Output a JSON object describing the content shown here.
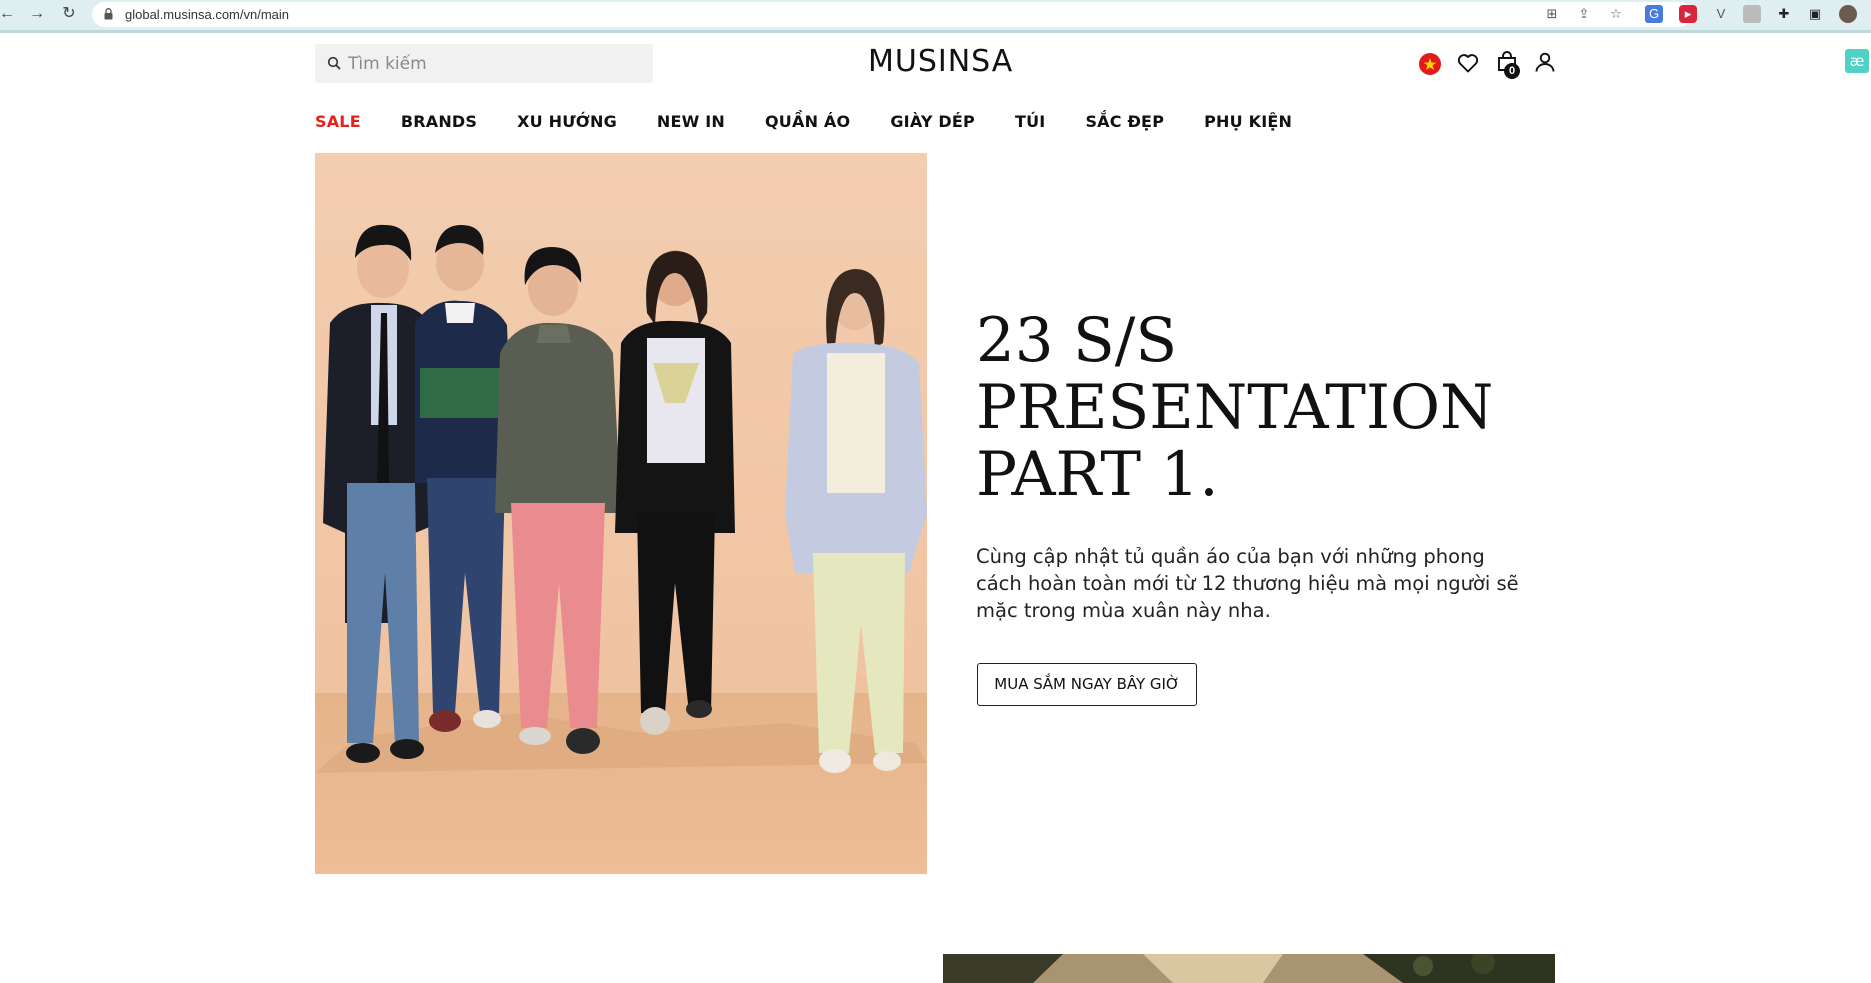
{
  "browser": {
    "url": "global.musinsa.com/vn/main",
    "back_icon": "back-arrow-icon",
    "forward_icon": "forward-arrow-icon",
    "reload_icon": "reload-icon",
    "extensions": [
      "translate-icon",
      "share-icon",
      "star-icon",
      "google-translate-icon",
      "record-icon",
      "v-extension-icon",
      "image-extension-icon",
      "puzzle-icon",
      "sidebar-icon",
      "profile-avatar"
    ]
  },
  "header": {
    "search_placeholder": "Tìm kiếm",
    "logo": "MUSINSA",
    "cart_count": "0",
    "side_badge": "æ"
  },
  "nav": {
    "items": [
      {
        "label": "SALE"
      },
      {
        "label": "BRANDS"
      },
      {
        "label": "XU HƯỚNG"
      },
      {
        "label": "NEW IN"
      },
      {
        "label": "QUẦN ÁO"
      },
      {
        "label": "GIÀY DÉP"
      },
      {
        "label": "TÚI"
      },
      {
        "label": "SẮC ĐẸP"
      },
      {
        "label": "PHỤ KIỆN"
      }
    ]
  },
  "hero": {
    "title_lines": [
      "23 S/S",
      "PRESENTATION",
      "PART 1."
    ],
    "description": "Cùng cập nhật tủ quần áo của bạn với những phong cách hoàn toàn mới từ 12 thương hiệu mà mọi người sẽ mặc trong mùa xuân này nha.",
    "cta": "MUA SẮM NGAY BÂY GIỜ"
  },
  "colors": {
    "sale": "#e2231a",
    "hero_bg": "#f2c9a8",
    "browser_bar": "#dfeef0"
  }
}
